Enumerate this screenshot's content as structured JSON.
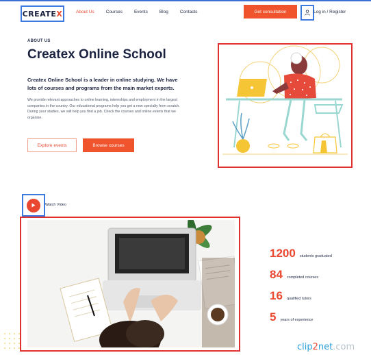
{
  "header": {
    "logo_main": "CREATE",
    "logo_accent": "X",
    "nav": [
      "About Us",
      "Courses",
      "Events",
      "Blog",
      "Contacts"
    ],
    "active_index": 0,
    "cta_label": "Get consultation",
    "login_label": "Log in / Register"
  },
  "hero": {
    "eyebrow": "ABOUT US",
    "title": "Createx Online School",
    "lead": "Createx Online School is a leader in online studying. We have lots of courses and programs from the main market experts.",
    "body": "We provide relevant approaches to online learning, internships and employment in the largest companies in the country. Our educational programs help you get a new specialty from scratch. During your studies, we will help you find a job. Check the courses and online events that we organise.",
    "btn_events": "Explore events",
    "btn_courses": "Browse courses"
  },
  "video": {
    "label": "Watch Video"
  },
  "stats": [
    {
      "number": "1200",
      "label": "students graduated"
    },
    {
      "number": "84",
      "label": "completed courses"
    },
    {
      "number": "16",
      "label": "qualified tutors"
    },
    {
      "number": "5",
      "label": "years of experience"
    }
  ],
  "watermark": {
    "a": "clip",
    "b": "2",
    "c": "net",
    "d": ".com"
  },
  "colors": {
    "accent": "#f0542d",
    "highlight_blue": "#3b7be0",
    "highlight_red": "#e03030",
    "text_dark": "#1c2340"
  }
}
